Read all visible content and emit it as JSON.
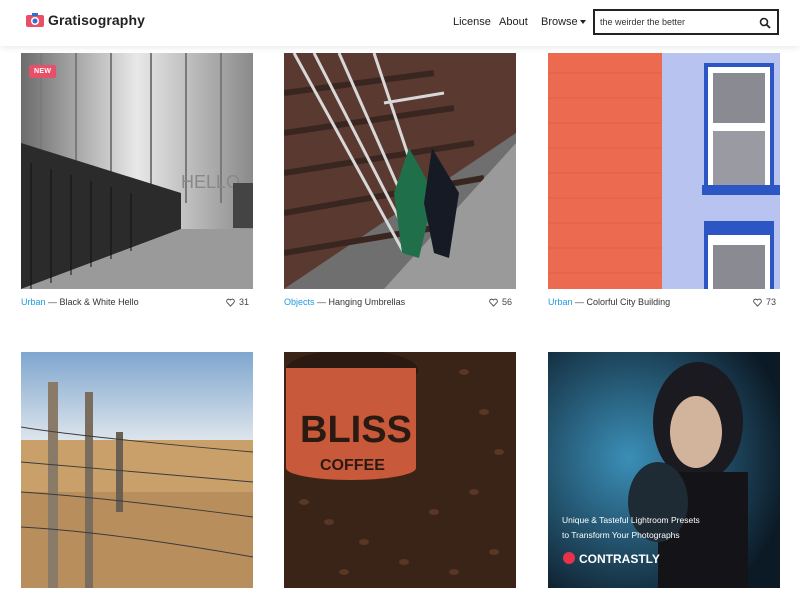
{
  "header": {
    "logo_text": "Gratisography",
    "nav": {
      "license": "License",
      "about": "About",
      "browse": "Browse"
    },
    "search": {
      "value": "the weirder the better",
      "placeholder": "the weirder the better"
    }
  },
  "photos": [
    {
      "category": "Urban",
      "title": "Black & White Hello",
      "likes": "31",
      "badge": "NEW",
      "wall_text": "HELLO"
    },
    {
      "category": "Objects",
      "title": "Hanging Umbrellas",
      "likes": "56"
    },
    {
      "category": "Urban",
      "title": "Colorful City Building",
      "likes": "73"
    },
    {
      "category": "",
      "title": "",
      "likes": ""
    },
    {
      "category": "",
      "title": "",
      "likes": "",
      "can_text_1": "BLISS",
      "can_text_2": "COFFEE"
    },
    {
      "category": "",
      "title": "",
      "likes": "",
      "ad_line_1": "Unique & Tasteful Lightroom Presets",
      "ad_line_2": "to Transform Your Photographs",
      "ad_brand": "CONTRASTLY"
    }
  ],
  "separator": "—",
  "colors": {
    "accent": "#1e9be0",
    "badge": "#e8506a",
    "brick": "#ec6a4f",
    "wall_blue": "#b9c3ef",
    "trim_blue": "#2c56c4"
  }
}
